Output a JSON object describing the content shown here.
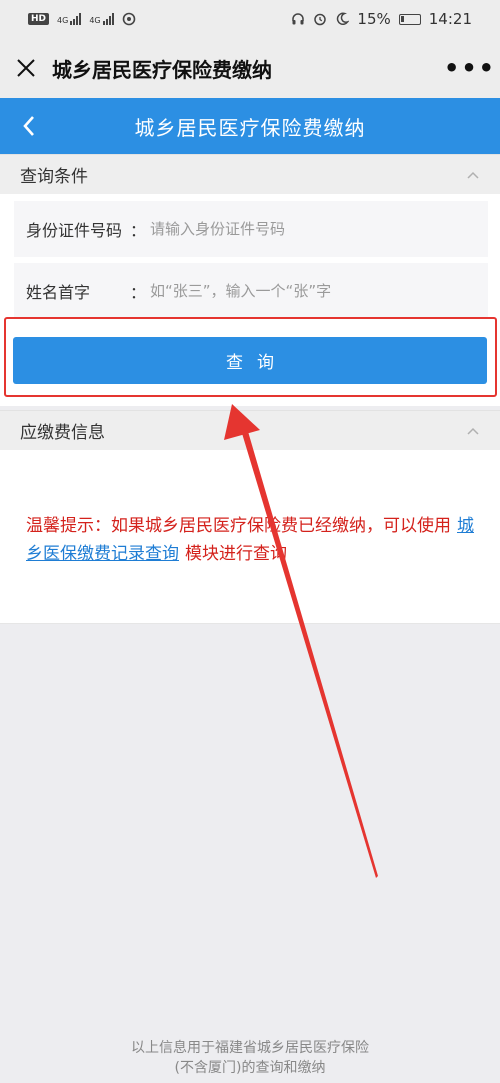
{
  "status_bar": {
    "hd": "HD",
    "net1": "4G",
    "net2": "4G",
    "battery": "15%",
    "time": "14:21"
  },
  "title_bar": {
    "title": "城乡居民医疗保险费缴纳",
    "more": "•••"
  },
  "page_header": {
    "title": "城乡居民医疗保险费缴纳"
  },
  "query_section": {
    "title": "查询条件",
    "fields": [
      {
        "label": "身份证件号码",
        "colon": "：",
        "placeholder": "请输入身份证件号码"
      },
      {
        "label": "姓名首字",
        "colon": "：",
        "placeholder": "如“张三”，输入一个“张”字"
      }
    ],
    "button_label": "查询"
  },
  "info_section": {
    "title": "应缴费信息",
    "tip_prefix": "温馨提示：如果城乡居民医疗保险费已经缴纳，可以使用",
    "tip_link": "城乡医保缴费记录查询",
    "tip_suffix": "模块进行查询"
  },
  "footer": {
    "line1": "以上信息用于福建省城乡居民医疗保险",
    "line2": "(不含厦门)的查询和缴纳"
  },
  "colors": {
    "accent_blue": "#2c8fe3",
    "warning_red": "#d4221c",
    "annotation_red": "#e53530",
    "link_blue": "#1f7dd4"
  }
}
